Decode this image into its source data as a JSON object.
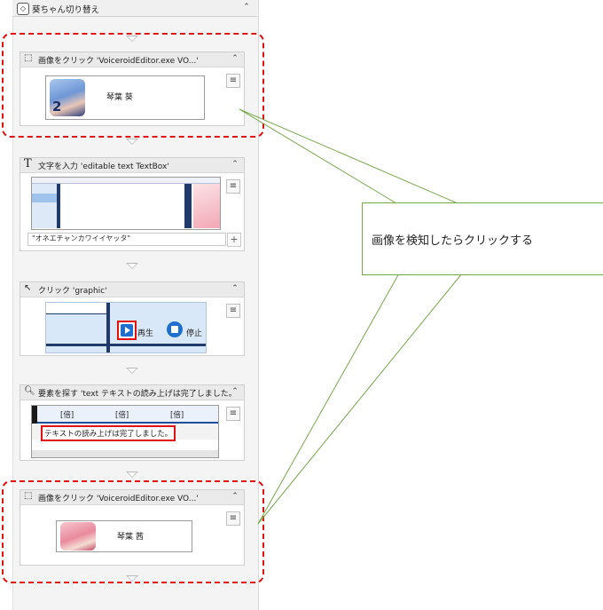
{
  "sequence": {
    "title": "葵ちゃん切り替え"
  },
  "activities": [
    {
      "icon": "click-image-icon",
      "label": "画像をクリック 'VoiceroidEditor.exe  VO...'",
      "thumb_text": "琴葉 葵"
    },
    {
      "icon": "type-text-icon",
      "label": "文字を入力 'editable text  TextBox'",
      "input_value": "\"オネエチャンカワイイヤッタ\""
    },
    {
      "icon": "click-icon",
      "label": "クリック 'graphic'",
      "play_label": "再生",
      "stop_label": "停止"
    },
    {
      "icon": "find-element-icon",
      "label": "要素を探す 'text  テキストの読み上げは完了しました。'",
      "columns": [
        "[倍]",
        "[倍]",
        "[倍]"
      ],
      "status_text": "テキストの読み上げは完了しました。"
    },
    {
      "icon": "click-image-icon",
      "label": "画像をクリック 'VoiceroidEditor.exe  VO...'",
      "thumb_text": "琴葉 茜"
    }
  ],
  "callout": {
    "text": "画像を検知したらクリックする"
  },
  "colors": {
    "highlight": "#e01010",
    "callout_border": "#76a84a",
    "accent_blue": "#1e6fd0",
    "navy": "#223a6a"
  }
}
